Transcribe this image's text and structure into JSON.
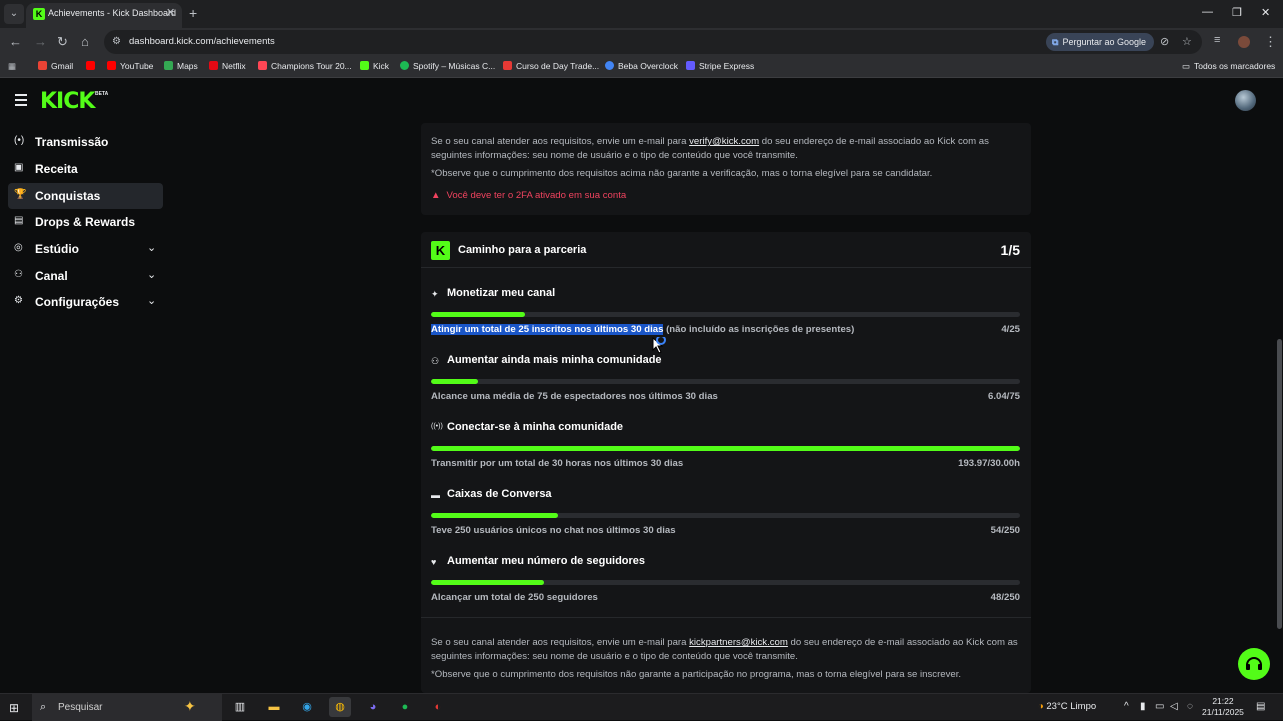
{
  "browser": {
    "tab_title": "Achievements - Kick Dashboard",
    "url": "dashboard.kick.com/achievements",
    "ask_google": "Perguntar ao Google",
    "bookmarks": [
      {
        "label": "Gmail",
        "color": "#ea4335"
      },
      {
        "label": "",
        "color": "#ff0000"
      },
      {
        "label": "YouTube",
        "color": "#ff0000"
      },
      {
        "label": "Maps",
        "color": "#34a853"
      },
      {
        "label": "Netflix",
        "color": "#e50914"
      },
      {
        "label": "Champions Tour 20...",
        "color": "#ff4655"
      },
      {
        "label": "Kick",
        "color": "#53fc18"
      },
      {
        "label": "Spotify – Músicas C...",
        "color": "#1db954"
      },
      {
        "label": "Curso de Day Trade...",
        "color": "#e53935"
      },
      {
        "label": "Beba Overclock",
        "color": "#4285f4"
      },
      {
        "label": "Stripe Express",
        "color": "#635bff"
      }
    ],
    "all_bookmarks": "Todos os marcadores"
  },
  "app": {
    "logo": "KICK",
    "logo_badge": "BETA",
    "nav": [
      {
        "label": "Transmissão",
        "icon": "broadcast-icon",
        "glyph": "(•)"
      },
      {
        "label": "Receita",
        "icon": "wallet-icon",
        "glyph": "▣"
      },
      {
        "label": "Conquistas",
        "icon": "trophy-icon",
        "glyph": "🏆",
        "active": true
      },
      {
        "label": "Drops & Rewards",
        "icon": "gift-icon",
        "glyph": "▤"
      },
      {
        "label": "Estúdio",
        "icon": "studio-icon",
        "glyph": "◎",
        "expandable": true
      },
      {
        "label": "Canal",
        "icon": "users-icon",
        "glyph": "⚇",
        "expandable": true
      },
      {
        "label": "Configurações",
        "icon": "gear-icon",
        "glyph": "⚙",
        "expandable": true
      }
    ]
  },
  "verification": {
    "text_before": "Se o seu canal atender aos requisitos, envie um e-mail para ",
    "email": "verify@kick.com",
    "text_after": " do seu endereço de e-mail associado ao Kick com as seguintes informações: seu nome de usuário e o tipo de conteúdo que você transmite.",
    "note": "*Observe que o cumprimento dos requisitos acima não garante a verificação, mas o torna elegível para se candidatar.",
    "warning": "Você deve ter o 2FA ativado em sua conta"
  },
  "partnership": {
    "title": "Caminho para a parceria",
    "progress": "1/5",
    "goals": [
      {
        "title": "Monetizar meu canal",
        "icon": "sparkle-icon",
        "glyph": "✦",
        "desc_selected": "Atingir um total de 25 inscritos nos últimos 30 dias",
        "desc": " (não incluído as inscrições de presentes)",
        "value": "4/25",
        "fraction": 0.16
      },
      {
        "title": "Aumentar ainda mais minha comunidade",
        "icon": "users-up-icon",
        "glyph": "⚇",
        "desc_selected": "",
        "desc": "Alcance uma média de 75 de espectadores nos últimos 30 dias",
        "value": "6.04/75",
        "fraction": 0.08
      },
      {
        "title": "Conectar-se à minha comunidade",
        "icon": "broadcast-icon",
        "glyph": "((•))",
        "desc_selected": "",
        "desc": "Transmitir por um total de 30 horas nos últimos 30 dias",
        "value": "193.97/30.00h",
        "fraction": 1.0
      },
      {
        "title": "Caixas de Conversa",
        "icon": "chat-icon",
        "glyph": "▬",
        "desc_selected": "",
        "desc": "Teve 250 usuários únicos no chat nos últimos 30 dias",
        "value": "54/250",
        "fraction": 0.216
      },
      {
        "title": "Aumentar meu número de seguidores",
        "icon": "heart-icon",
        "glyph": "♥",
        "desc_selected": "",
        "desc": "Alcançar um total de 250 seguidores",
        "value": "48/250",
        "fraction": 0.192
      }
    ],
    "footer_before": "Se o seu canal atender aos requisitos, envie um e-mail para ",
    "footer_email": "kickpartners@kick.com",
    "footer_after": " do seu endereço de e-mail associado ao Kick com as seguintes informações: seu nome de usuário e o tipo de conteúdo que você transmite.",
    "footer_note": "*Observe que o cumprimento dos requisitos não garante a participação no programa, mas o torna elegível para se inscrever."
  },
  "taskbar": {
    "search_placeholder": "Pesquisar",
    "weather": "23°C  Limpo",
    "time": "21:22",
    "date": "21/11/2025"
  }
}
